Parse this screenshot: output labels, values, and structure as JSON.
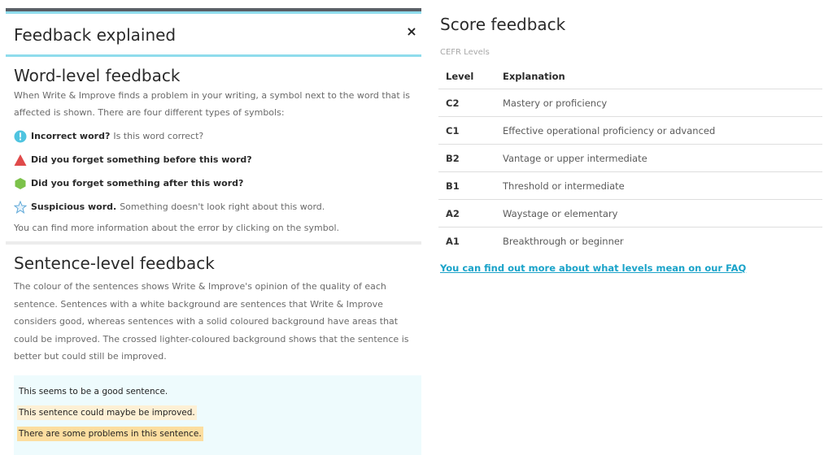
{
  "modal": {
    "title": "Feedback explained",
    "close_label": "×",
    "word_level": {
      "heading": "Word-level feedback",
      "intro": "When Write & Improve finds a problem in your writing, a symbol next to the word that is affected is shown. There are four different types of symbols:",
      "symbols": [
        {
          "icon": "info-circle-icon",
          "color": "#4fc4e0",
          "bold": "Incorrect word?",
          "text": "Is this word correct?"
        },
        {
          "icon": "triangle-warning-icon",
          "color": "#e04a4a",
          "bold": "Did you forget something before this word?",
          "text": ""
        },
        {
          "icon": "hexagon-icon",
          "color": "#7cc24a",
          "bold": "Did you forget something after this word?",
          "text": ""
        },
        {
          "icon": "star-outline-icon",
          "color": "#5ea8d8",
          "bold": "Suspicious word.",
          "text": "Something doesn't look right about this word."
        }
      ],
      "note": "You can find more information about the error by clicking on the symbol."
    },
    "sentence_level": {
      "heading": "Sentence-level feedback",
      "paragraph": "The colour of the sentences shows Write & Improve's opinion of the quality of each sentence. Sentences with a white background are sentences that Write & Improve considers good, whereas sentences with a solid coloured background have areas that could be improved. The crossed lighter-coloured background shows that the sentence is better but could still be improved.",
      "examples": [
        "This seems to be a good sentence.",
        "This sentence could maybe be improved.",
        "There are some problems in this sentence."
      ]
    }
  },
  "score": {
    "title": "Score feedback",
    "cefr_label": "CEFR Levels",
    "columns": [
      "Level",
      "Explanation"
    ],
    "rows": [
      {
        "level": "C2",
        "explanation": "Mastery or proficiency"
      },
      {
        "level": "C1",
        "explanation": "Effective operational proficiency or advanced"
      },
      {
        "level": "B2",
        "explanation": "Vantage or upper intermediate"
      },
      {
        "level": "B1",
        "explanation": "Threshold or intermediate"
      },
      {
        "level": "A2",
        "explanation": "Waystage or elementary"
      },
      {
        "level": "A1",
        "explanation": "Breakthrough or beginner"
      }
    ],
    "faq_link": "You can find out more about what levels mean on our FAQ"
  }
}
